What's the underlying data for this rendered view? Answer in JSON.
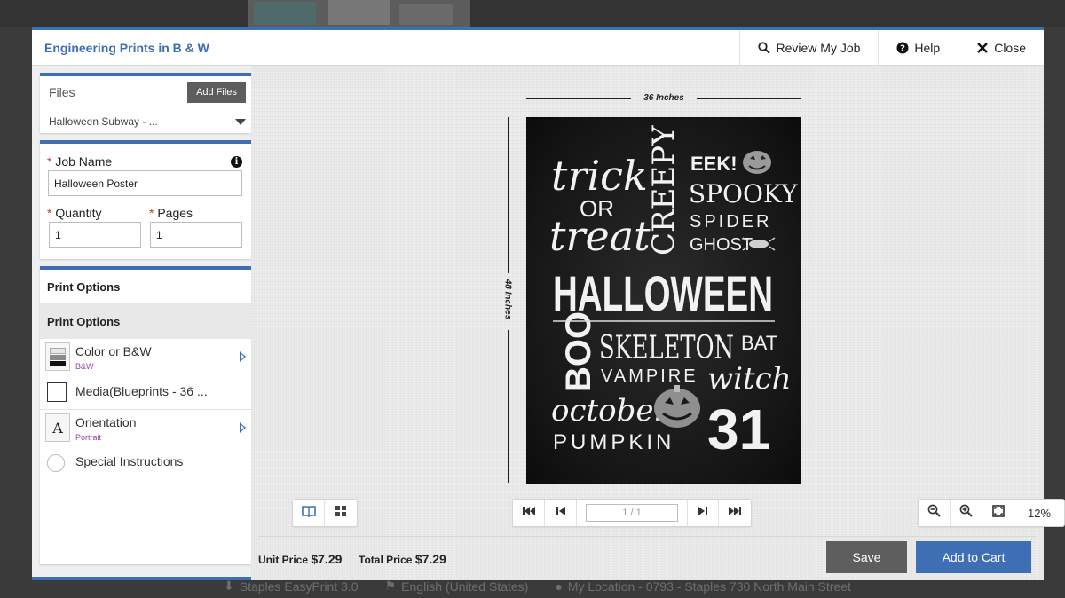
{
  "header": {
    "title": "Engineering Prints in B & W",
    "review_label": "Review My Job",
    "help_label": "Help",
    "close_label": "Close"
  },
  "files": {
    "label": "Files",
    "add_label": "Add Files",
    "selected_file": "Halloween Subway - ..."
  },
  "job": {
    "required_mark": "*",
    "name_label": "Job Name",
    "name_value": "Halloween Poster",
    "info_glyph": "i",
    "quantity_label": "Quantity",
    "quantity_value": "1",
    "pages_label": "Pages",
    "pages_value": "1"
  },
  "print_options": {
    "title": "Print Options",
    "section_label": "Print Options",
    "items": [
      {
        "label": "Color or B&W",
        "value": "B&W",
        "icon": "color-bw-icon"
      },
      {
        "label": "Media(Blueprints - 36 ...",
        "value": "",
        "icon": "checkbox-icon"
      },
      {
        "label": "Orientation",
        "value": "Portrait",
        "icon": "orientation-icon",
        "glyph": "A"
      },
      {
        "label": "Special Instructions",
        "value": "",
        "icon": "radio-icon"
      }
    ]
  },
  "preview": {
    "width_label": "36 Inches",
    "height_label": "48 Inches",
    "poster_text": {
      "w1": "trick",
      "w2": "OR",
      "w3": "treat",
      "w4": "CREEPY",
      "w5": "EEK!",
      "w6": "SPOOKY",
      "w7": "SPIDER",
      "w8": "GHOST",
      "w9": "HALLOWEEN",
      "w10": "BOO",
      "w11": "SKELETON",
      "w12": "BAT",
      "w13": "VAMPIRE",
      "w14": "witch",
      "w15": "october",
      "w16": "31",
      "w17": "PUMPKIN"
    }
  },
  "pager": {
    "page_value": "1 / 1"
  },
  "zoom": {
    "level": "12%"
  },
  "pricing": {
    "unit_label": "Unit Price",
    "unit_value": "$7.29",
    "total_label": "Total Price",
    "total_value": "$7.29"
  },
  "actions": {
    "save_label": "Save",
    "cart_label": "Add to Cart"
  },
  "backdrop_footer": {
    "app_version": "Staples EasyPrint 3.0",
    "language": "English (United States)",
    "location": "My Location - 0793 - Staples 730 North Main Street"
  },
  "colors": {
    "accent": "#3e6fb5",
    "required": "#c0392b",
    "option_value": "#9b3fb5",
    "save_button": "#5e5e5e"
  }
}
